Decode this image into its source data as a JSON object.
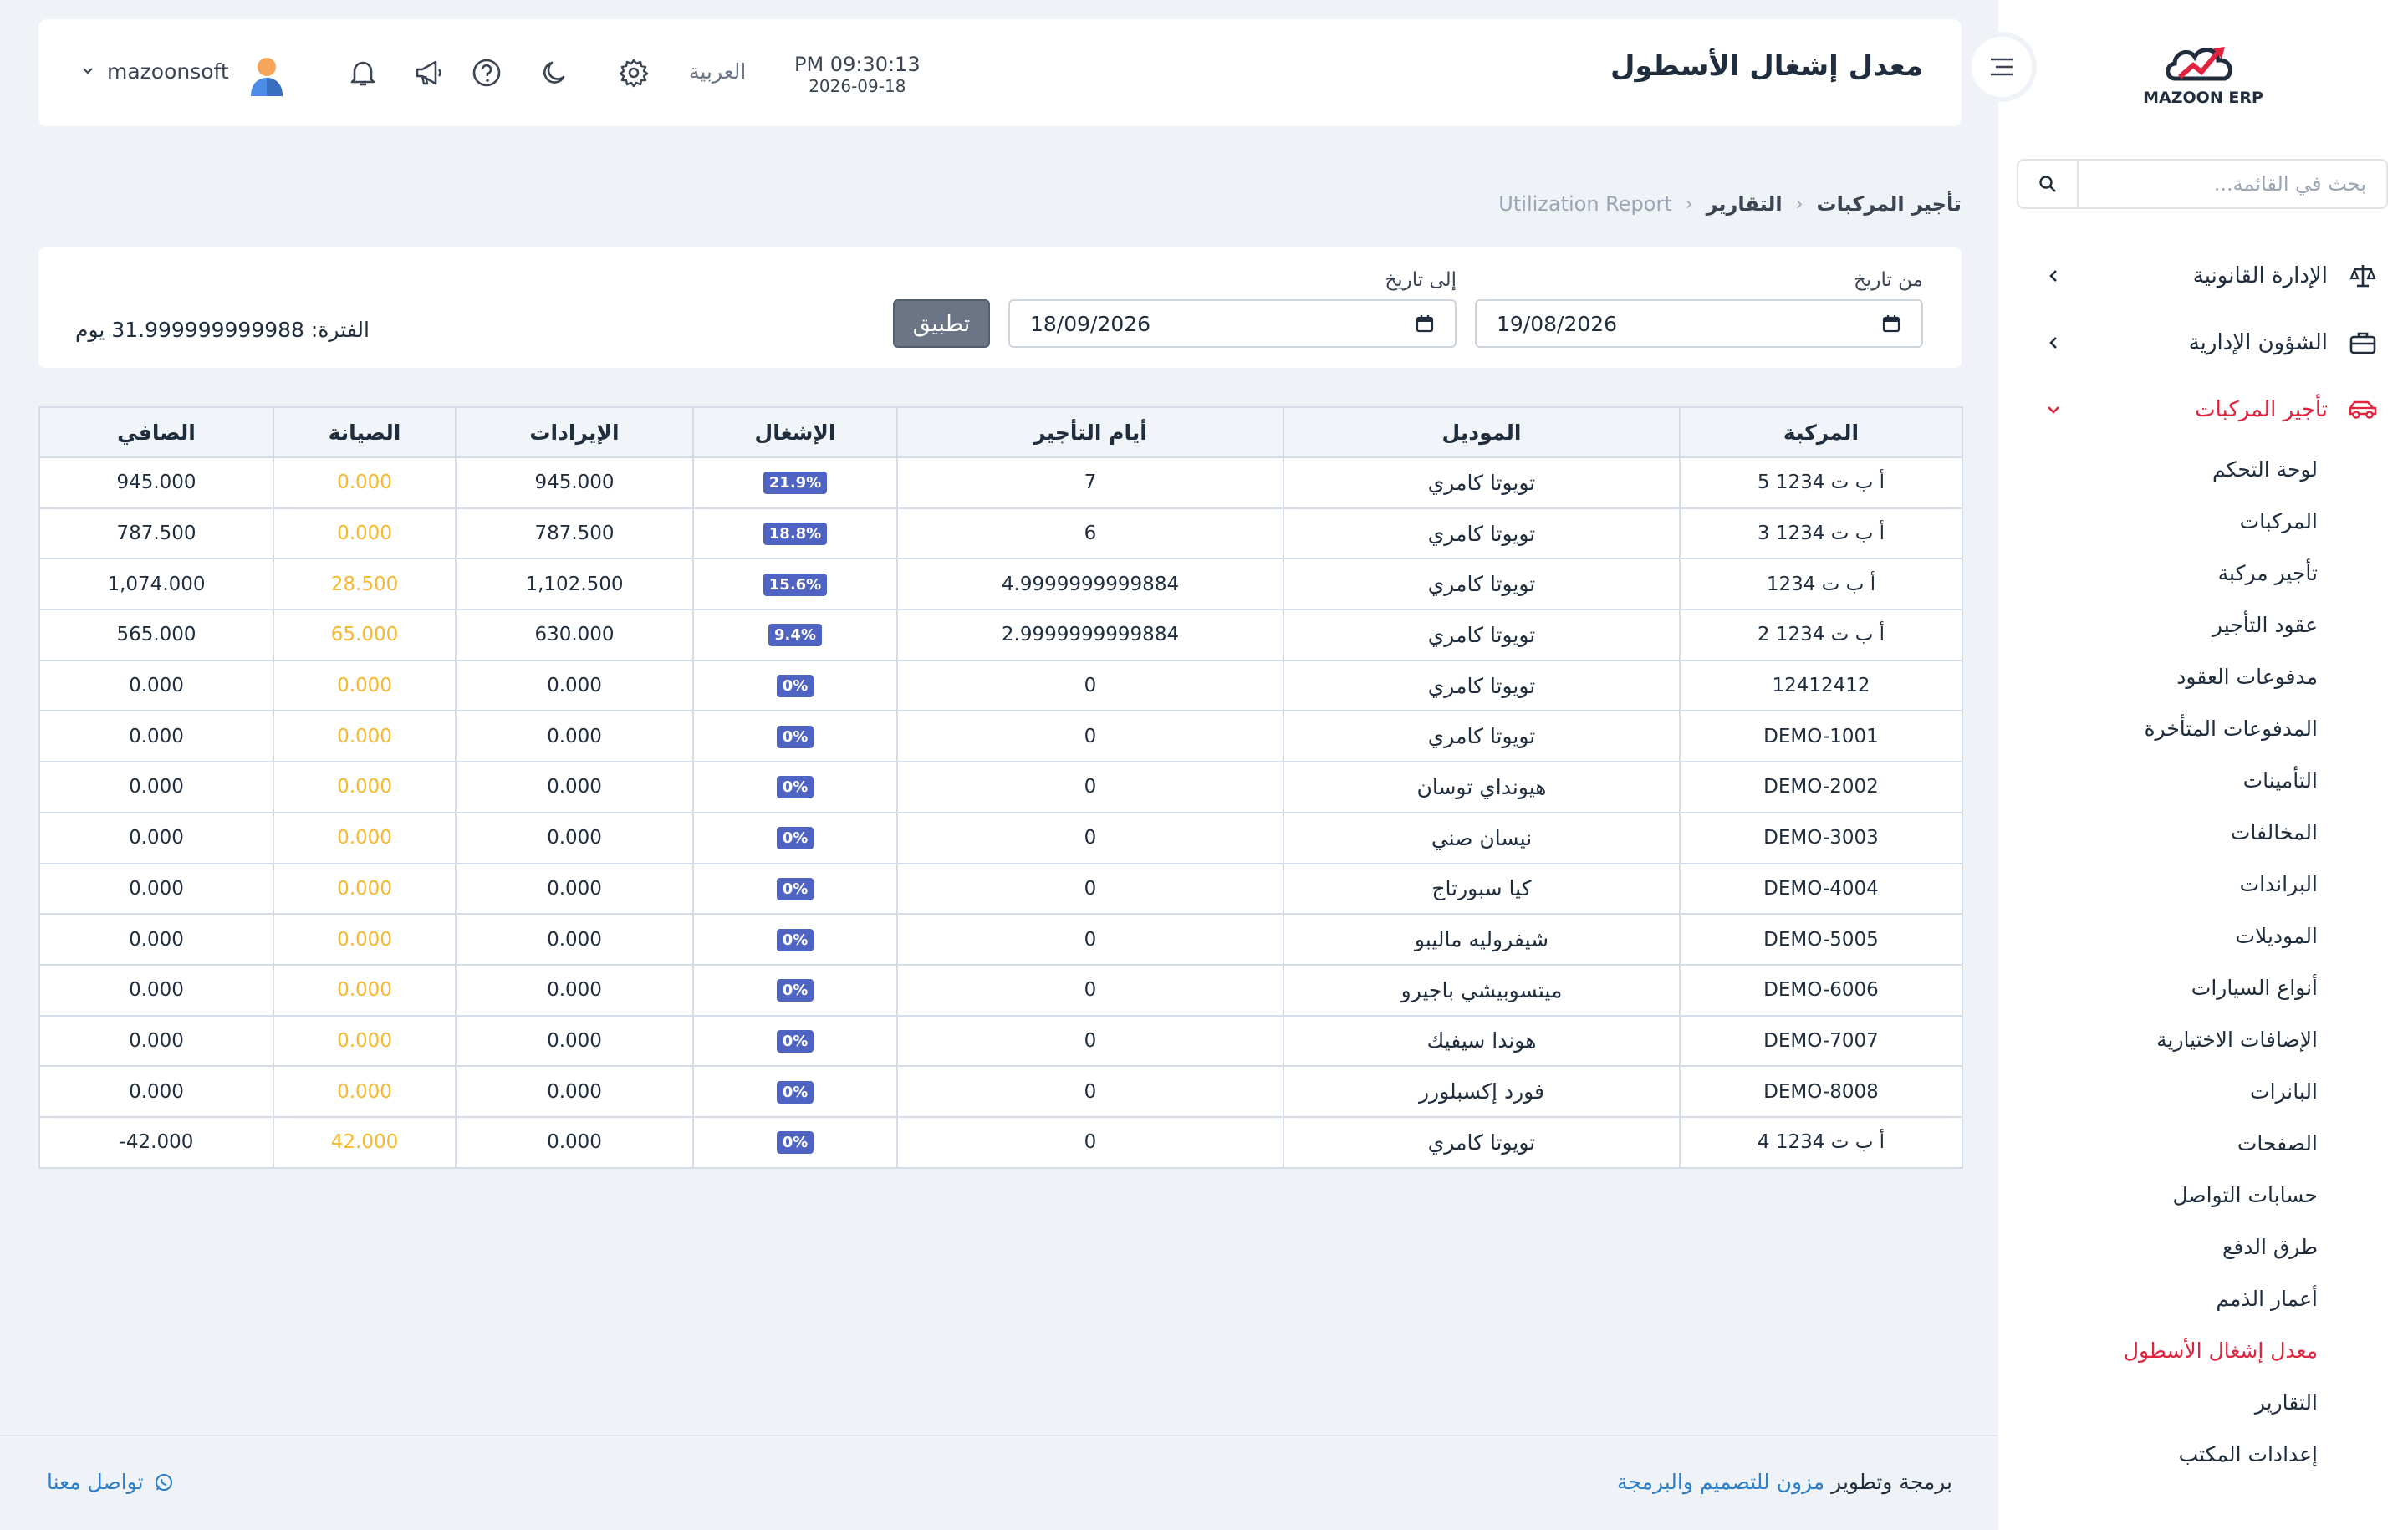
{
  "colors": {
    "accent": "#e0243f",
    "badge": "#4f63c2",
    "maintenance": "#f5b82e",
    "link": "#2a7fc8",
    "apply_button": "#6b7585"
  },
  "sidebar": {
    "logo_text": "MAZOON ERP",
    "search_placeholder": "بحث في القائمة...",
    "groups": [
      {
        "label": "الإدارة القانونية",
        "icon": "scales-icon"
      },
      {
        "label": "الشؤون الإدارية",
        "icon": "briefcase-icon"
      },
      {
        "label": "تأجير المركبات",
        "icon": "car-icon"
      }
    ],
    "subitems": [
      "لوحة التحكم",
      "المركبات",
      "تأجير مركبة",
      "عقود التأجير",
      "مدفوعات العقود",
      "المدفوعات المتأخرة",
      "التأمينات",
      "المخالفات",
      "البراندات",
      "الموديلات",
      "أنواع السيارات",
      "الإضافات الاختيارية",
      "البانرات",
      "الصفحات",
      "حسابات التواصل",
      "طرق الدفع",
      "أعمار الذمم",
      "معدل إشغال الأسطول",
      "التقارير",
      "إعدادات المكتب"
    ]
  },
  "header": {
    "title": "معدل إشغال الأسطول",
    "time": "PM 09:30:13",
    "date": "2026-09-18",
    "language": "العربية",
    "username": "mazoonsoft"
  },
  "breadcrumb": {
    "items": [
      "تأجير المركبات",
      "التقارير",
      "Utilization Report"
    ]
  },
  "filters": {
    "from_label": "من تاريخ",
    "from_value": "19/08/2026",
    "to_label": "إلى تاريخ",
    "to_value": "18/09/2026",
    "apply_label": "تطبيق",
    "period_text": "الفترة: 31.999999999988 يوم"
  },
  "table": {
    "columns": [
      "المركبة",
      "الموديل",
      "أيام التأجير",
      "الإشغال",
      "الإيرادات",
      "الصيانة",
      "الصافي"
    ],
    "rows": [
      {
        "vehicle": "أ ب ت 1234 5",
        "model": "تويوتا كامري",
        "days": "7",
        "occupancy": "21.9%",
        "revenue": "945.000",
        "maintenance": "0.000",
        "net": "945.000"
      },
      {
        "vehicle": "أ ب ت 1234 3",
        "model": "تويوتا كامري",
        "days": "6",
        "occupancy": "18.8%",
        "revenue": "787.500",
        "maintenance": "0.000",
        "net": "787.500"
      },
      {
        "vehicle": "أ ب ت 1234",
        "model": "تويوتا كامري",
        "days": "4.9999999999884",
        "occupancy": "15.6%",
        "revenue": "1,102.500",
        "maintenance": "28.500",
        "net": "1,074.000"
      },
      {
        "vehicle": "أ ب ت 1234 2",
        "model": "تويوتا كامري",
        "days": "2.9999999999884",
        "occupancy": "9.4%",
        "revenue": "630.000",
        "maintenance": "65.000",
        "net": "565.000"
      },
      {
        "vehicle": "12412412",
        "model": "تويوتا كامري",
        "days": "0",
        "occupancy": "0%",
        "revenue": "0.000",
        "maintenance": "0.000",
        "net": "0.000"
      },
      {
        "vehicle": "DEMO-1001",
        "model": "تويوتا كامري",
        "days": "0",
        "occupancy": "0%",
        "revenue": "0.000",
        "maintenance": "0.000",
        "net": "0.000"
      },
      {
        "vehicle": "DEMO-2002",
        "model": "هيونداي توسان",
        "days": "0",
        "occupancy": "0%",
        "revenue": "0.000",
        "maintenance": "0.000",
        "net": "0.000"
      },
      {
        "vehicle": "DEMO-3003",
        "model": "نيسان صني",
        "days": "0",
        "occupancy": "0%",
        "revenue": "0.000",
        "maintenance": "0.000",
        "net": "0.000"
      },
      {
        "vehicle": "DEMO-4004",
        "model": "كيا سبورتاج",
        "days": "0",
        "occupancy": "0%",
        "revenue": "0.000",
        "maintenance": "0.000",
        "net": "0.000"
      },
      {
        "vehicle": "DEMO-5005",
        "model": "شيفروليه ماليبو",
        "days": "0",
        "occupancy": "0%",
        "revenue": "0.000",
        "maintenance": "0.000",
        "net": "0.000"
      },
      {
        "vehicle": "DEMO-6006",
        "model": "ميتسوبيشي باجيرو",
        "days": "0",
        "occupancy": "0%",
        "revenue": "0.000",
        "maintenance": "0.000",
        "net": "0.000"
      },
      {
        "vehicle": "DEMO-7007",
        "model": "هوندا سيفيك",
        "days": "0",
        "occupancy": "0%",
        "revenue": "0.000",
        "maintenance": "0.000",
        "net": "0.000"
      },
      {
        "vehicle": "DEMO-8008",
        "model": "فورد إكسبلورر",
        "days": "0",
        "occupancy": "0%",
        "revenue": "0.000",
        "maintenance": "0.000",
        "net": "0.000"
      },
      {
        "vehicle": "أ ب ت 1234 4",
        "model": "تويوتا كامري",
        "days": "0",
        "occupancy": "0%",
        "revenue": "0.000",
        "maintenance": "42.000",
        "net": "-42.000"
      }
    ]
  },
  "footer": {
    "credit_prefix": "برمجة وتطوير",
    "credit_brand": "مزون للتصميم والبرمجة",
    "contact": "تواصل معنا"
  }
}
